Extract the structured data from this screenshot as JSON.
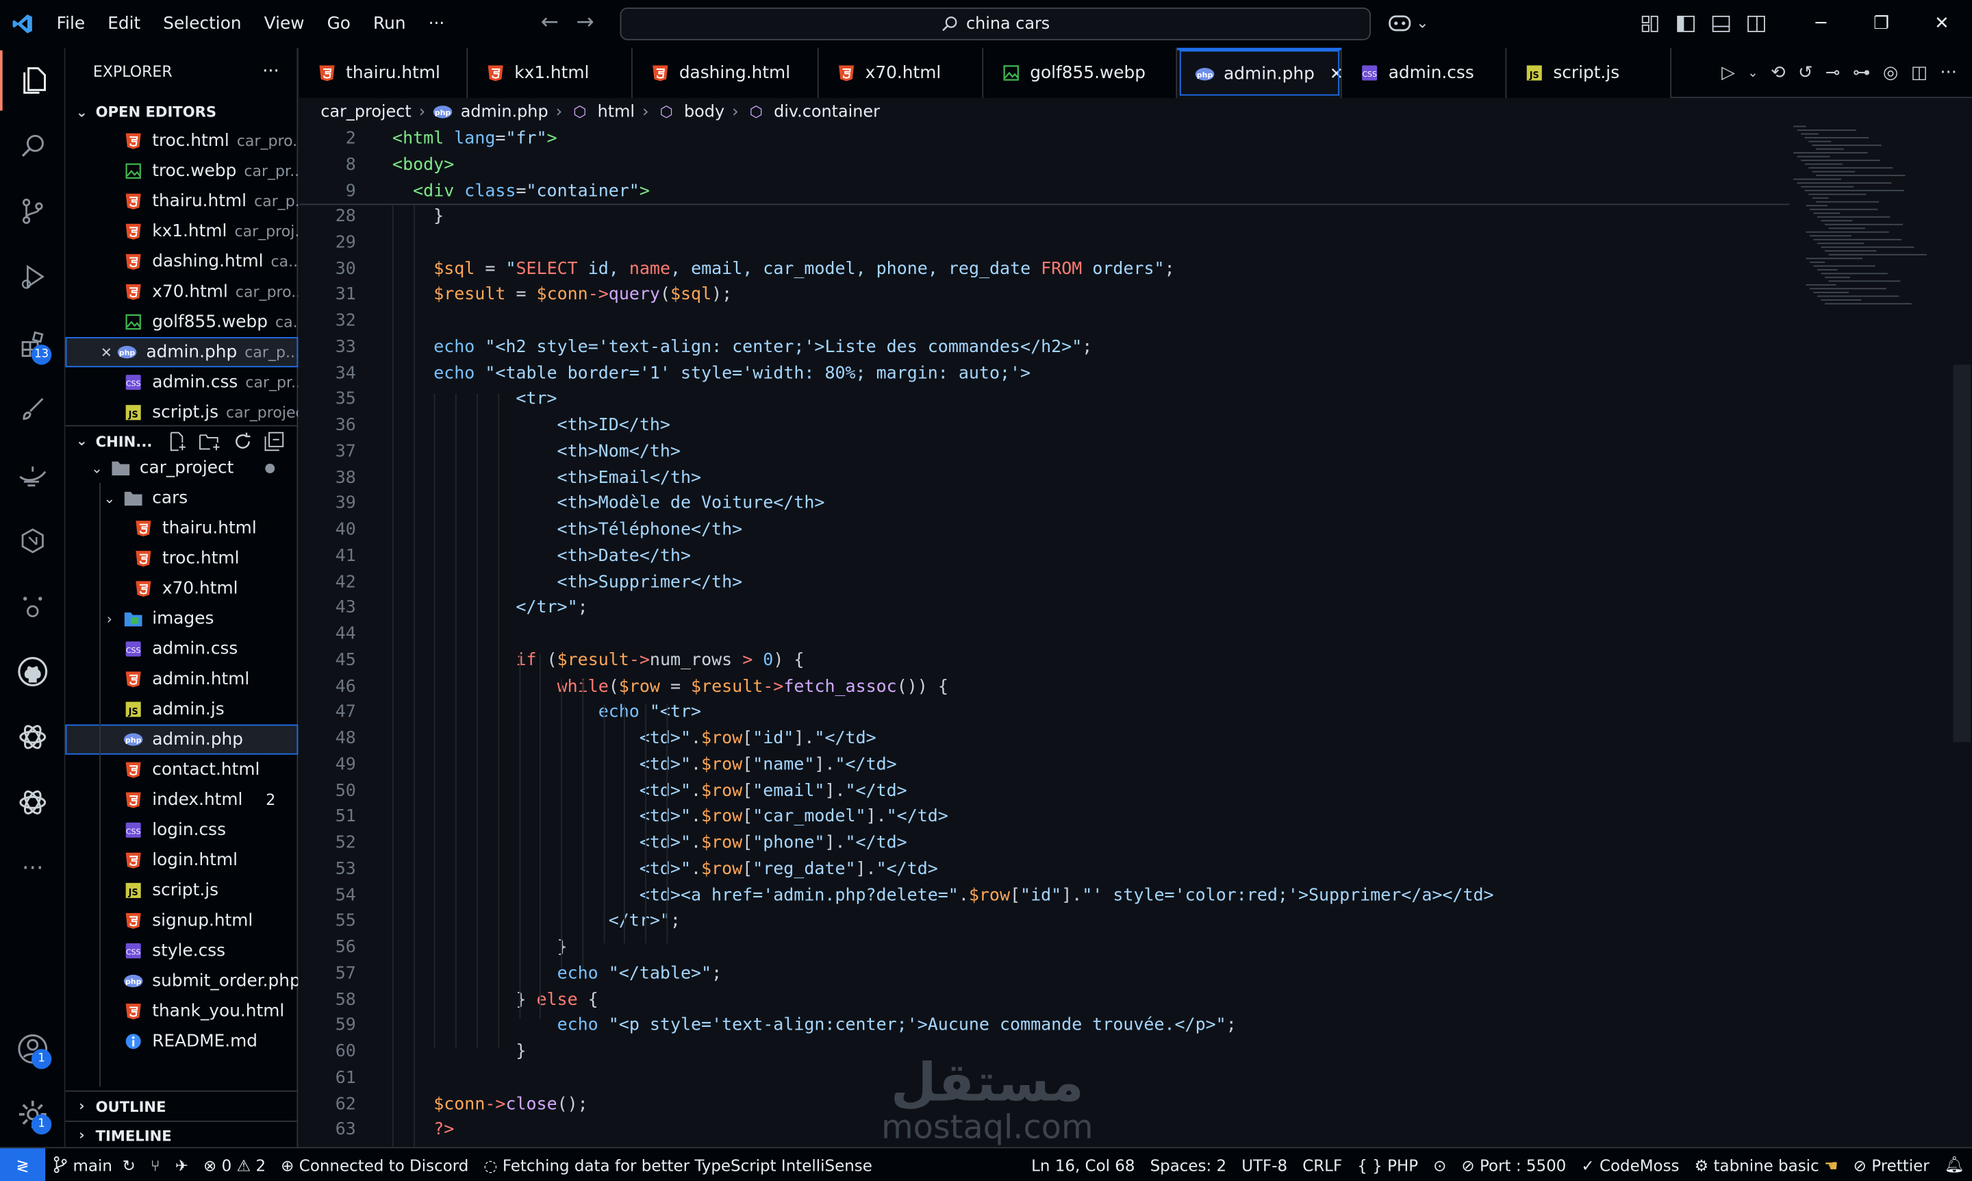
{
  "menu": [
    "File",
    "Edit",
    "Selection",
    "View",
    "Go",
    "Run",
    "···"
  ],
  "search": {
    "text": "china cars"
  },
  "explorer": {
    "title": "EXPLORER",
    "more": "···",
    "open_editors_label": "OPEN EDITORS",
    "workspace_label": "CHIN...",
    "outline_label": "OUTLINE",
    "timeline_label": "TIMELINE"
  },
  "open_editors": [
    {
      "name": "troc.html",
      "path": "car_pro...",
      "type": "html"
    },
    {
      "name": "troc.webp",
      "path": "car_pr...",
      "type": "img"
    },
    {
      "name": "thairu.html",
      "path": "car_p...",
      "type": "html"
    },
    {
      "name": "kx1.html",
      "path": "car_proj...",
      "type": "html"
    },
    {
      "name": "dashing.html",
      "path": "ca...",
      "type": "html"
    },
    {
      "name": "x70.html",
      "path": "car_pro...",
      "type": "html"
    },
    {
      "name": "golf855.webp",
      "path": "ca...",
      "type": "img"
    },
    {
      "name": "admin.php",
      "path": "car_p...",
      "type": "php",
      "active": true
    },
    {
      "name": "admin.css",
      "path": "car_pr...",
      "type": "css"
    },
    {
      "name": "script.js",
      "path": "car_project",
      "type": "js"
    }
  ],
  "tree": {
    "project": "car_project",
    "cars_folder": "cars",
    "cars_files": [
      "thairu.html",
      "troc.html",
      "x70.html"
    ],
    "images_folder": "images",
    "files": [
      {
        "name": "admin.css",
        "type": "css"
      },
      {
        "name": "admin.html",
        "type": "html"
      },
      {
        "name": "admin.js",
        "type": "js"
      },
      {
        "name": "admin.php",
        "type": "php",
        "selected": true
      },
      {
        "name": "contact.html",
        "type": "html"
      },
      {
        "name": "index.html",
        "type": "html",
        "badge": "2"
      },
      {
        "name": "login.css",
        "type": "css"
      },
      {
        "name": "login.html",
        "type": "html"
      },
      {
        "name": "script.js",
        "type": "js"
      },
      {
        "name": "signup.html",
        "type": "html"
      },
      {
        "name": "style.css",
        "type": "css"
      },
      {
        "name": "submit_order.php",
        "type": "php"
      },
      {
        "name": "thank_you.html",
        "type": "html"
      },
      {
        "name": "README.md",
        "type": "info"
      }
    ]
  },
  "tabs": [
    {
      "label": "thairu.html",
      "type": "html"
    },
    {
      "label": "kx1.html",
      "type": "html"
    },
    {
      "label": "dashing.html",
      "type": "html"
    },
    {
      "label": "x70.html",
      "type": "html"
    },
    {
      "label": "golf855.webp",
      "type": "img"
    },
    {
      "label": "admin.php",
      "type": "php",
      "active": true
    },
    {
      "label": "admin.css",
      "type": "css"
    },
    {
      "label": "script.js",
      "type": "js"
    }
  ],
  "breadcrumb": [
    "car_project",
    "admin.php",
    "html",
    "body",
    "div.container"
  ],
  "sticky_lines": [
    {
      "n": "2",
      "tokens": [
        [
          "tag",
          "<html "
        ],
        [
          "attr",
          "lang"
        ],
        [
          "pl",
          "="
        ],
        [
          "str",
          "\"fr\""
        ],
        [
          "tag",
          ">"
        ]
      ]
    },
    {
      "n": "8",
      "tokens": [
        [
          "tag",
          "<body>"
        ]
      ]
    },
    {
      "n": "9",
      "tokens": [
        [
          "pl",
          "  "
        ],
        [
          "tag",
          "<div "
        ],
        [
          "attr",
          "class"
        ],
        [
          "pl",
          "="
        ],
        [
          "str",
          "\"container\""
        ],
        [
          "tag",
          ">"
        ]
      ]
    }
  ],
  "lines": [
    {
      "n": "28",
      "tokens": [
        [
          "pl",
          "    }"
        ]
      ]
    },
    {
      "n": "29",
      "tokens": []
    },
    {
      "n": "30",
      "tokens": [
        [
          "pl",
          "    "
        ],
        [
          "var",
          "$sql"
        ],
        [
          "pl",
          " = "
        ],
        [
          "str",
          "\""
        ],
        [
          "kw",
          "SELECT"
        ],
        [
          "str",
          " id, "
        ],
        [
          "kw",
          "name"
        ],
        [
          "str",
          ", email, car_model, phone, reg_date "
        ],
        [
          "kw",
          "FROM"
        ],
        [
          "str",
          " orders\""
        ],
        [
          "pl",
          ";"
        ]
      ]
    },
    {
      "n": "31",
      "tokens": [
        [
          "pl",
          "    "
        ],
        [
          "var",
          "$result"
        ],
        [
          "pl",
          " = "
        ],
        [
          "var",
          "$conn"
        ],
        [
          "kw",
          "->"
        ],
        [
          "fn",
          "query"
        ],
        [
          "pl",
          "("
        ],
        [
          "var",
          "$sql"
        ],
        [
          "pl",
          ");"
        ]
      ]
    },
    {
      "n": "32",
      "tokens": []
    },
    {
      "n": "33",
      "tokens": [
        [
          "pl",
          "    "
        ],
        [
          "attr",
          "echo"
        ],
        [
          "pl",
          " "
        ],
        [
          "str",
          "\"<h2 style='text-align: center;'>Liste des commandes</h2>\""
        ],
        [
          "pl",
          ";"
        ]
      ]
    },
    {
      "n": "34",
      "tokens": [
        [
          "pl",
          "    "
        ],
        [
          "attr",
          "echo"
        ],
        [
          "pl",
          " "
        ],
        [
          "str",
          "\"<table border='1' style='width: 80%; margin: auto;'>"
        ]
      ]
    },
    {
      "n": "35",
      "tokens": [
        [
          "str",
          "            <tr>"
        ]
      ]
    },
    {
      "n": "36",
      "tokens": [
        [
          "str",
          "                <th>ID</th>"
        ]
      ]
    },
    {
      "n": "37",
      "tokens": [
        [
          "str",
          "                <th>Nom</th>"
        ]
      ]
    },
    {
      "n": "38",
      "tokens": [
        [
          "str",
          "                <th>Email</th>"
        ]
      ]
    },
    {
      "n": "39",
      "tokens": [
        [
          "str",
          "                <th>Modèle de Voiture</th>"
        ]
      ]
    },
    {
      "n": "40",
      "tokens": [
        [
          "str",
          "                <th>Téléphone</th>"
        ]
      ]
    },
    {
      "n": "41",
      "tokens": [
        [
          "str",
          "                <th>Date</th>"
        ]
      ]
    },
    {
      "n": "42",
      "tokens": [
        [
          "str",
          "                <th>Supprimer</th>"
        ]
      ]
    },
    {
      "n": "43",
      "tokens": [
        [
          "str",
          "            </tr>\""
        ],
        [
          "pl",
          ";"
        ]
      ]
    },
    {
      "n": "44",
      "tokens": []
    },
    {
      "n": "45",
      "tokens": [
        [
          "pl",
          "            "
        ],
        [
          "kw",
          "if"
        ],
        [
          "pl",
          " ("
        ],
        [
          "var",
          "$result"
        ],
        [
          "kw",
          "->"
        ],
        [
          "pl",
          "num_rows "
        ],
        [
          "kw",
          ">"
        ],
        [
          "pl",
          " "
        ],
        [
          "attr",
          "0"
        ],
        [
          "pl",
          ") {"
        ]
      ]
    },
    {
      "n": "46",
      "tokens": [
        [
          "pl",
          "                "
        ],
        [
          "kw",
          "while"
        ],
        [
          "pl",
          "("
        ],
        [
          "var",
          "$row"
        ],
        [
          "pl",
          " = "
        ],
        [
          "var",
          "$result"
        ],
        [
          "kw",
          "->"
        ],
        [
          "fn",
          "fetch_assoc"
        ],
        [
          "pl",
          "()) {"
        ]
      ]
    },
    {
      "n": "47",
      "tokens": [
        [
          "pl",
          "                    "
        ],
        [
          "attr",
          "echo"
        ],
        [
          "pl",
          " "
        ],
        [
          "str",
          "\"<tr>"
        ]
      ]
    },
    {
      "n": "48",
      "tokens": [
        [
          "str",
          "                        <td>\""
        ],
        [
          "pl",
          "."
        ],
        [
          "var",
          "$row"
        ],
        [
          "pl",
          "["
        ],
        [
          "str",
          "\"id\""
        ],
        [
          "pl",
          "]."
        ],
        [
          "str",
          "\"</td>"
        ]
      ]
    },
    {
      "n": "49",
      "tokens": [
        [
          "str",
          "                        <td>\""
        ],
        [
          "pl",
          "."
        ],
        [
          "var",
          "$row"
        ],
        [
          "pl",
          "["
        ],
        [
          "str",
          "\"name\""
        ],
        [
          "pl",
          "]."
        ],
        [
          "str",
          "\"</td>"
        ]
      ]
    },
    {
      "n": "50",
      "tokens": [
        [
          "str",
          "                        <td>\""
        ],
        [
          "pl",
          "."
        ],
        [
          "var",
          "$row"
        ],
        [
          "pl",
          "["
        ],
        [
          "str",
          "\"email\""
        ],
        [
          "pl",
          "]."
        ],
        [
          "str",
          "\"</td>"
        ]
      ]
    },
    {
      "n": "51",
      "tokens": [
        [
          "str",
          "                        <td>\""
        ],
        [
          "pl",
          "."
        ],
        [
          "var",
          "$row"
        ],
        [
          "pl",
          "["
        ],
        [
          "str",
          "\"car_model\""
        ],
        [
          "pl",
          "]."
        ],
        [
          "str",
          "\"</td>"
        ]
      ]
    },
    {
      "n": "52",
      "tokens": [
        [
          "str",
          "                        <td>\""
        ],
        [
          "pl",
          "."
        ],
        [
          "var",
          "$row"
        ],
        [
          "pl",
          "["
        ],
        [
          "str",
          "\"phone\""
        ],
        [
          "pl",
          "]."
        ],
        [
          "str",
          "\"</td>"
        ]
      ]
    },
    {
      "n": "53",
      "tokens": [
        [
          "str",
          "                        <td>\""
        ],
        [
          "pl",
          "."
        ],
        [
          "var",
          "$row"
        ],
        [
          "pl",
          "["
        ],
        [
          "str",
          "\"reg_date\""
        ],
        [
          "pl",
          "]."
        ],
        [
          "str",
          "\"</td>"
        ]
      ]
    },
    {
      "n": "54",
      "tokens": [
        [
          "str",
          "                        <td><a href='admin.php?delete=\""
        ],
        [
          "pl",
          "."
        ],
        [
          "var",
          "$row"
        ],
        [
          "pl",
          "["
        ],
        [
          "str",
          "\"id\""
        ],
        [
          "pl",
          "]."
        ],
        [
          "str",
          "\"' style='color:red;'>Supprimer</a></td>"
        ]
      ]
    },
    {
      "n": "55",
      "tokens": [
        [
          "str",
          "                     </tr>\""
        ],
        [
          "pl",
          ";"
        ]
      ]
    },
    {
      "n": "56",
      "tokens": [
        [
          "pl",
          "                }"
        ]
      ]
    },
    {
      "n": "57",
      "tokens": [
        [
          "pl",
          "                "
        ],
        [
          "attr",
          "echo"
        ],
        [
          "pl",
          " "
        ],
        [
          "str",
          "\"</table>\""
        ],
        [
          "pl",
          ";"
        ]
      ]
    },
    {
      "n": "58",
      "tokens": [
        [
          "pl",
          "            } "
        ],
        [
          "kw",
          "else"
        ],
        [
          "pl",
          " {"
        ]
      ]
    },
    {
      "n": "59",
      "tokens": [
        [
          "pl",
          "                "
        ],
        [
          "attr",
          "echo"
        ],
        [
          "pl",
          " "
        ],
        [
          "str",
          "\"<p style='text-align:center;'>Aucune commande trouvée.</p>\""
        ],
        [
          "pl",
          ";"
        ]
      ]
    },
    {
      "n": "60",
      "tokens": [
        [
          "pl",
          "            }"
        ]
      ]
    },
    {
      "n": "61",
      "tokens": []
    },
    {
      "n": "62",
      "tokens": [
        [
          "pl",
          "    "
        ],
        [
          "var",
          "$conn"
        ],
        [
          "kw",
          "->"
        ],
        [
          "fn",
          "close"
        ],
        [
          "pl",
          "();"
        ]
      ]
    },
    {
      "n": "63",
      "tokens": [
        [
          "pl",
          "    "
        ],
        [
          "kw",
          "?>"
        ]
      ]
    }
  ],
  "watermark": {
    "arabic": "مستقل",
    "latin": "mostaql.com"
  },
  "status": {
    "branch": "main",
    "errors": "0",
    "warnings": "2",
    "discord": "Connected to Discord",
    "fetching": "Fetching data for better TypeScript IntelliSense",
    "position": "Ln 16, Col 68",
    "spaces": "Spaces: 2",
    "encoding": "UTF-8",
    "eol": "CRLF",
    "language": "PHP",
    "port": "Port : 5500",
    "codemoss": "CodeMoss",
    "tabnine": "tabnine basic",
    "prettier": "Prettier"
  },
  "badges": {
    "extensions": "13",
    "accounts": "1",
    "settings": "1"
  },
  "colors": {
    "accent": "#1f6feb",
    "html": "#e34c26",
    "css": "#6e4fd6",
    "js": "#cbcb41",
    "php": "#6f8fe8"
  }
}
